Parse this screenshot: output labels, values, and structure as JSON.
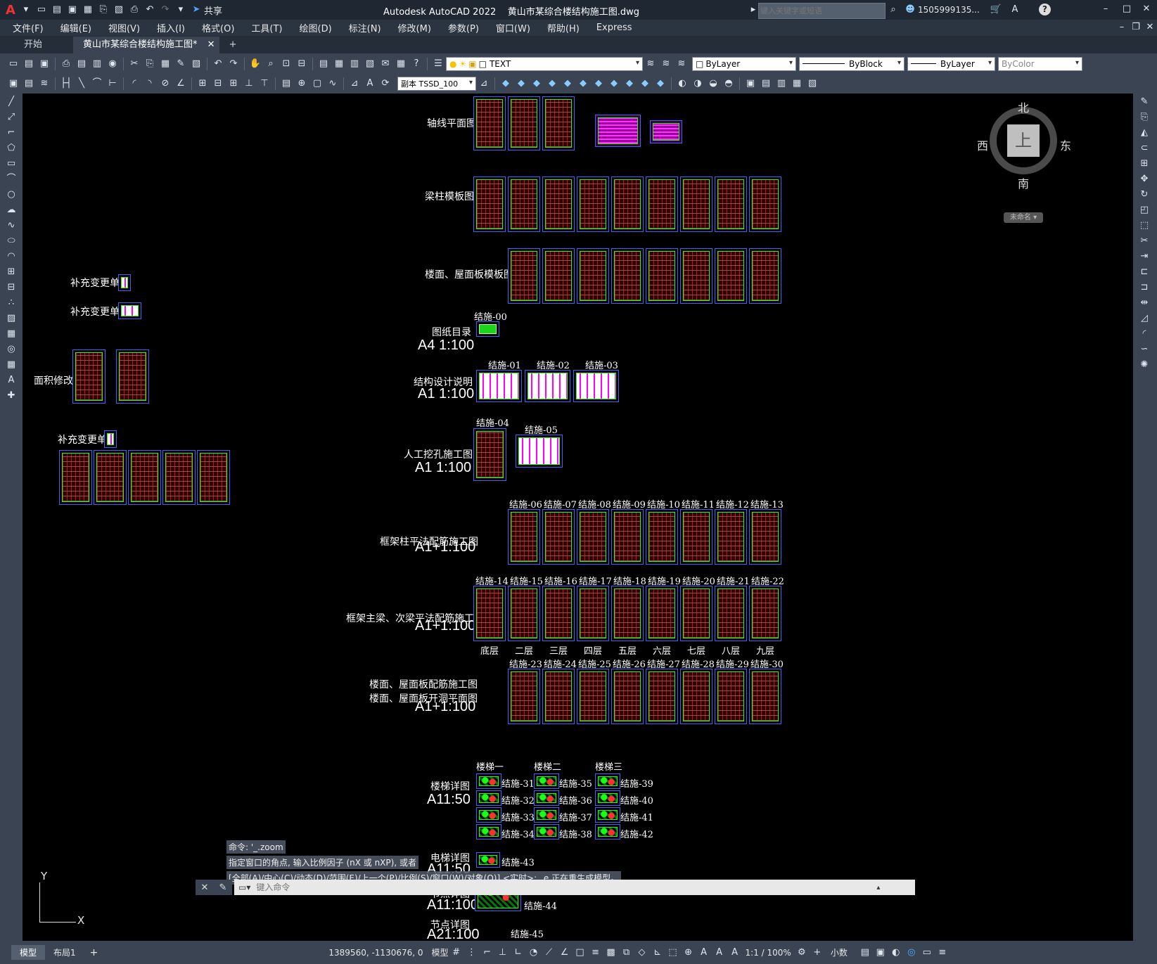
{
  "titlebar": {
    "app_letter": "A",
    "share_label": "共享",
    "title": "Autodesk AutoCAD 2022    黄山市某综合楼结构施工图.dwg",
    "search_placeholder": "键入关键字或短语",
    "user": "1505999135...",
    "help": "?"
  },
  "menu": [
    "文件(F)",
    "编辑(E)",
    "视图(V)",
    "插入(I)",
    "格式(O)",
    "工具(T)",
    "绘图(D)",
    "标注(N)",
    "修改(M)",
    "参数(P)",
    "窗口(W)",
    "帮助(H)",
    "Express"
  ],
  "tabs": {
    "start": "开始",
    "active": "黄山市某综合楼结构施工图*",
    "add": "+"
  },
  "props": {
    "layer": "TEXT",
    "style": "副本 TSSD_100",
    "color": "ByLayer",
    "linetype": "ByBlock",
    "lineweight": "ByLayer",
    "plotstyle": "ByColor"
  },
  "viewcube": {
    "north": "北",
    "south": "南",
    "east": "东",
    "west": "西",
    "top": "上",
    "wcs": "未命名"
  },
  "canvas": {
    "groups": [
      {
        "name": "轴线平面图"
      },
      {
        "name": "梁柱模板图"
      },
      {
        "name": "楼面、屋面板模板图"
      },
      {
        "name": "图纸目录",
        "scale": "A4  1:100",
        "sheet": "结施-00"
      },
      {
        "name": "结构设计说明",
        "scale": "A1  1:100",
        "sheets": [
          "结施-01",
          "结施-02",
          "结施-03"
        ]
      },
      {
        "name": "人工挖孔施工图",
        "scale": "A1  1:100",
        "sheets": [
          "结施-04",
          "结施-05"
        ]
      },
      {
        "name": "框架柱平法配筋施工图",
        "scale": "A1+1:100",
        "sheets": [
          "结施-06",
          "结施-07",
          "结施-08",
          "结施-09",
          "结施-10",
          "结施-11",
          "结施-12",
          "结施-13"
        ]
      },
      {
        "name": "框架主梁、次梁平法配筋施工图",
        "scale": "A1+1:100",
        "sheets": [
          "结施-14",
          "结施-15",
          "结施-16",
          "结施-17",
          "结施-18",
          "结施-19",
          "结施-20",
          "结施-21",
          "结施-22"
        ],
        "floors": [
          "底层",
          "二层",
          "三层",
          "四层",
          "五层",
          "六层",
          "七层",
          "八层",
          "九层"
        ]
      },
      {
        "name": "楼面、屋面板配筋施工图",
        "name2": "楼面、屋面板开洞平面图",
        "scale": "A1+1:100",
        "sheets": [
          "结施-23",
          "结施-24",
          "结施-25",
          "结施-26",
          "结施-27",
          "结施-28",
          "结施-29",
          "结施-30"
        ]
      },
      {
        "name": "楼梯详图",
        "scale": "A11:50",
        "stairs": [
          "楼梯一",
          "楼梯二",
          "楼梯三"
        ],
        "sheets": [
          "结施-31",
          "结施-32",
          "结施-33",
          "结施-34",
          "结施-35",
          "结施-36",
          "结施-37",
          "结施-38",
          "结施-39",
          "结施-40",
          "结施-41",
          "结施-42"
        ]
      },
      {
        "name": "电梯详图",
        "scale": "A11:50",
        "sheet": "结施-43"
      },
      {
        "name": "节点详图",
        "scale": "A11:100",
        "sheet": "结施-44"
      },
      {
        "name": "节点详图",
        "scale": "A21:100",
        "sheet": "结施-45"
      }
    ],
    "left": {
      "change1": "补充变更单1",
      "change2": "补充变更单2",
      "change3": "补充变更单3",
      "revise": "面积修改图"
    }
  },
  "command": {
    "history": [
      "命令: '_.zoom",
      "指定窗口的角点, 输入比例因子 (nX 或 nXP), 或者",
      "[全部(A)/中心(C)/动态(D)/范围(E)/上一个(P)/比例(S)/窗口(W)/对象(O)] <实时>: _e 正在重生成模型。"
    ],
    "placeholder": "键入命令"
  },
  "status": {
    "tab_model": "模型",
    "tab_layout": "布局1",
    "add": "+",
    "coords": "1389560, -1130676, 0",
    "space": "模型",
    "scale": "1:1 / 100%",
    "units": "小数"
  },
  "ucs": {
    "x": "X",
    "y": "Y"
  }
}
